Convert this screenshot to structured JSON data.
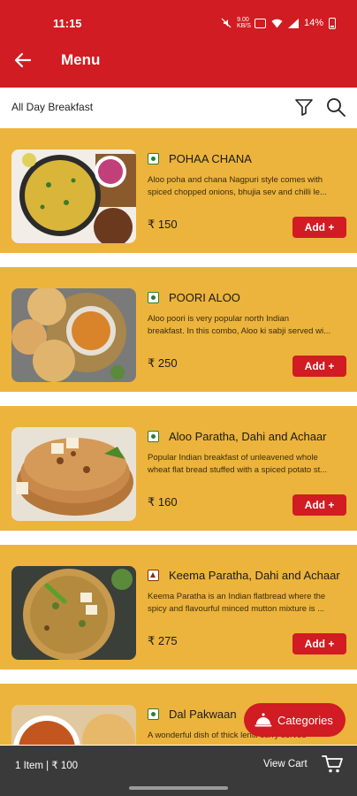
{
  "status_bar": {
    "time": "11:15",
    "battery": "14%",
    "network_speed": "9.00 KB/S"
  },
  "app_bar": {
    "title": "Menu"
  },
  "filter_bar": {
    "label": "All Day Breakfast"
  },
  "menu_items": [
    {
      "name": "POHAA CHANA",
      "type": "veg",
      "desc_line1": "Aloo poha and chana Nagpuri style comes with",
      "desc_line2": "spiced chopped onions, bhujia sev and chilli le...",
      "price": "₹ 150",
      "add_label": "Add +"
    },
    {
      "name": "POORI ALOO",
      "type": "veg",
      "desc_line1": "Aloo poori is very popular north Indian",
      "desc_line2": "breakfast. In this combo, Aloo ki sabji served wi...",
      "price": "₹ 250",
      "add_label": "Add +"
    },
    {
      "name": "Aloo Paratha, Dahi and Achaar",
      "type": "veg",
      "desc_line1": "Popular Indian breakfast of unleavened whole",
      "desc_line2": "wheat flat bread stuffed with a spiced potato st...",
      "price": "₹ 160",
      "add_label": "Add +"
    },
    {
      "name": "Keema Paratha, Dahi and Achaar",
      "type": "nonveg",
      "desc_line1": "Keema Paratha is an Indian flatbread where the",
      "desc_line2": "spicy and flavourful minced mutton mixture is ...",
      "price": "₹ 275",
      "add_label": "Add +"
    },
    {
      "name": "Dal Pakwaan",
      "type": "veg",
      "desc_line1": "A wonderful dish of thick lentil curry served",
      "desc_line2": "",
      "price": "",
      "add_label": ""
    }
  ],
  "fab": {
    "label": "Categories"
  },
  "cart_bar": {
    "summary": "1 Item | ₹ 100",
    "view_label": "View Cart"
  },
  "colors": {
    "brand_red": "#d01c22",
    "card_bg": "#ecb43c",
    "bottom_bar": "#3a3a3a"
  }
}
